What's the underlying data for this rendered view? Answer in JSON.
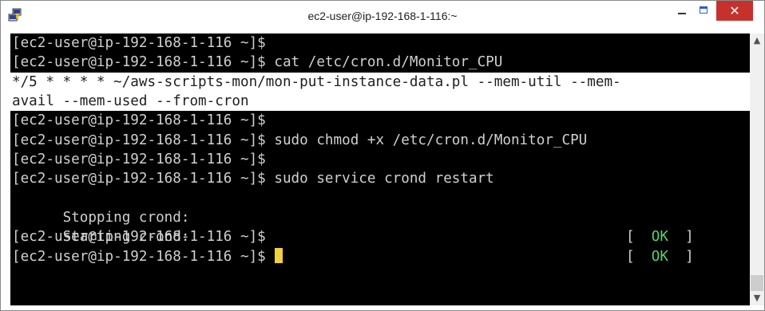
{
  "window": {
    "title": "ec2-user@ip-192-168-1-116:~",
    "app_icon": "putty-icon",
    "controls": {
      "minimize_icon": "minimize-icon",
      "maximize_icon": "maximize-icon",
      "close_icon": "close-icon",
      "close_glyph": "✕"
    }
  },
  "terminal": {
    "lines": [
      {
        "text": "[ec2-user@ip-192-168-1-116 ~]$"
      },
      {
        "text": "[ec2-user@ip-192-168-1-116 ~]$ cat /etc/cron.d/Monitor_CPU"
      },
      {
        "text": "*/5 * * * * ~/aws-scripts-mon/mon-put-instance-data.pl --mem-util --mem-"
      },
      {
        "text": "avail --mem-used --from-cron"
      },
      {
        "text": "[ec2-user@ip-192-168-1-116 ~]$"
      },
      {
        "text": "[ec2-user@ip-192-168-1-116 ~]$ sudo chmod +x /etc/cron.d/Monitor_CPU"
      },
      {
        "text": "[ec2-user@ip-192-168-1-116 ~]$"
      },
      {
        "text": "[ec2-user@ip-192-168-1-116 ~]$ sudo service crond restart"
      },
      {
        "text": "Stopping crond:",
        "open": "[  ",
        "status": "OK",
        "close": "  ]"
      },
      {
        "text": "Starting crond:",
        "open": "[  ",
        "status": "OK",
        "close": "  ]"
      },
      {
        "text": "[ec2-user@ip-192-168-1-116 ~]$"
      },
      {
        "text": "[ec2-user@ip-192-168-1-116 ~]$ "
      }
    ],
    "colors": {
      "background": "#000000",
      "foreground": "#d0d0d0",
      "ok": "#58d26a",
      "cursor": "#f1d03a",
      "highlight": "#ffffff"
    }
  },
  "scrollbar": {
    "up_icon": "scroll-up-arrow-icon",
    "down_icon": "scroll-down-arrow-icon",
    "up_glyph": "▲",
    "down_glyph": "▼"
  }
}
